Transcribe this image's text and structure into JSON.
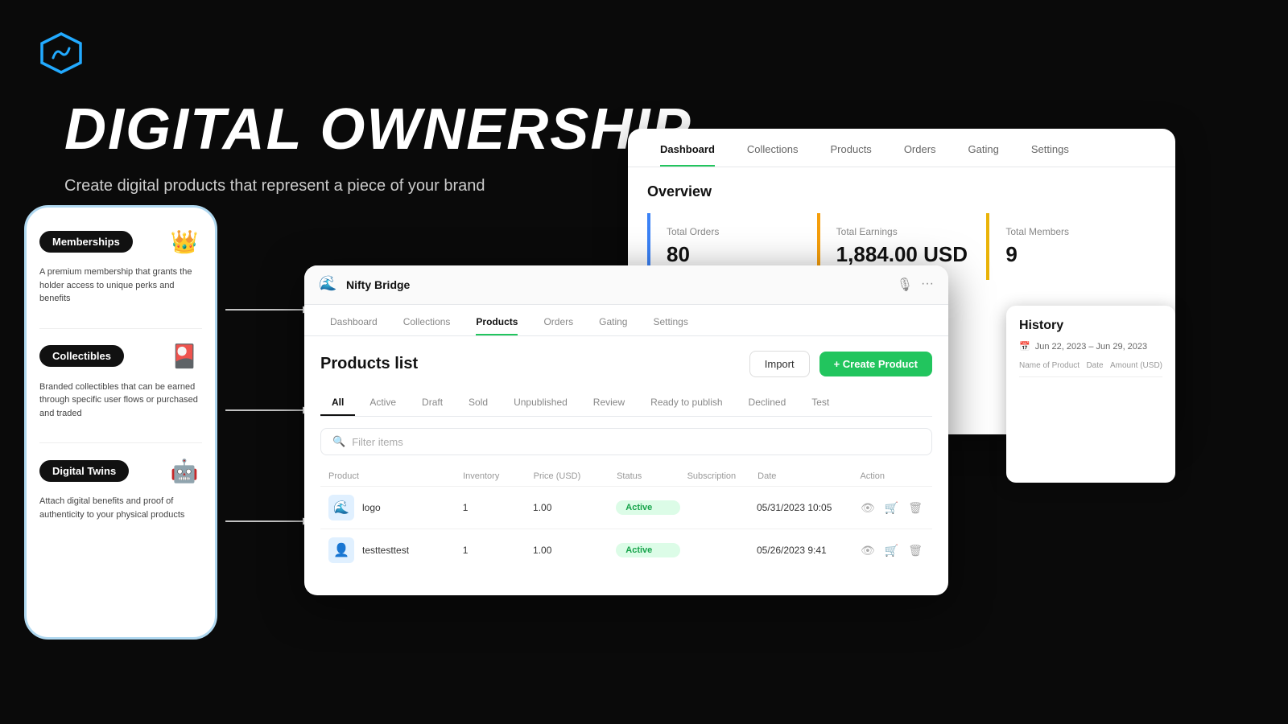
{
  "logo": {
    "alt": "NiftyBridge hexagon logo"
  },
  "hero": {
    "title": "DIGITAL OWNERSHIP",
    "subtitle": "Create digital products that represent a piece of your brand"
  },
  "phone": {
    "items": [
      {
        "tag": "Memberships",
        "icon": "👑",
        "desc": "A premium membership that grants the holder access to unique perks and benefits"
      },
      {
        "tag": "Collectibles",
        "icon": "🎴",
        "desc": "Branded collectibles that can be earned through specific user flows or purchased and traded"
      },
      {
        "tag": "Digital Twins",
        "icon": "🤖",
        "desc": "Attach digital benefits and proof of authenticity to your physical products"
      }
    ]
  },
  "dashboard_bg": {
    "nav": [
      {
        "label": "Dashboard",
        "active": true
      },
      {
        "label": "Collections",
        "active": false
      },
      {
        "label": "Products",
        "active": false
      },
      {
        "label": "Orders",
        "active": false
      },
      {
        "label": "Gating",
        "active": false
      },
      {
        "label": "Settings",
        "active": false
      }
    ],
    "overview_title": "Overview",
    "cards": [
      {
        "label": "Total Orders",
        "value": "80",
        "suffix": ""
      },
      {
        "label": "Total Earnings",
        "value": "1,884.00 USD",
        "suffix": ""
      },
      {
        "label": "Total Members",
        "value": "9",
        "suffix": ""
      }
    ]
  },
  "history": {
    "title": "History",
    "date_range": "Jun 22, 2023 – Jun 29, 2023",
    "columns": [
      "Name of Product",
      "Date",
      "Amount (USD)"
    ]
  },
  "products_panel": {
    "app_name": "Nifty Bridge",
    "nav": [
      {
        "label": "Dashboard",
        "active": false
      },
      {
        "label": "Collections",
        "active": false
      },
      {
        "label": "Products",
        "active": true
      },
      {
        "label": "Orders",
        "active": false
      },
      {
        "label": "Gating",
        "active": false
      },
      {
        "label": "Settings",
        "active": false
      }
    ],
    "list_title": "Products list",
    "btn_import": "Import",
    "btn_create": "+ Create Product",
    "tabs": [
      {
        "label": "All",
        "active": true
      },
      {
        "label": "Active",
        "active": false
      },
      {
        "label": "Draft",
        "active": false
      },
      {
        "label": "Sold",
        "active": false
      },
      {
        "label": "Unpublished",
        "active": false
      },
      {
        "label": "Review",
        "active": false
      },
      {
        "label": "Ready to publish",
        "active": false
      },
      {
        "label": "Declined",
        "active": false
      },
      {
        "label": "Test",
        "active": false
      }
    ],
    "search_placeholder": "Filter items",
    "table_headers": [
      "Product",
      "Inventory",
      "Price (USD)",
      "Status",
      "Subscription",
      "Date",
      "Action"
    ],
    "rows": [
      {
        "name": "logo",
        "icon": "🌊",
        "inventory": "1",
        "price": "1.00",
        "status": "Active",
        "subscription": "",
        "date": "05/31/2023 10:05"
      },
      {
        "name": "testtesttest",
        "icon": "👤",
        "inventory": "1",
        "price": "1.00",
        "status": "Active",
        "subscription": "",
        "date": "05/26/2023 9:41"
      }
    ]
  }
}
